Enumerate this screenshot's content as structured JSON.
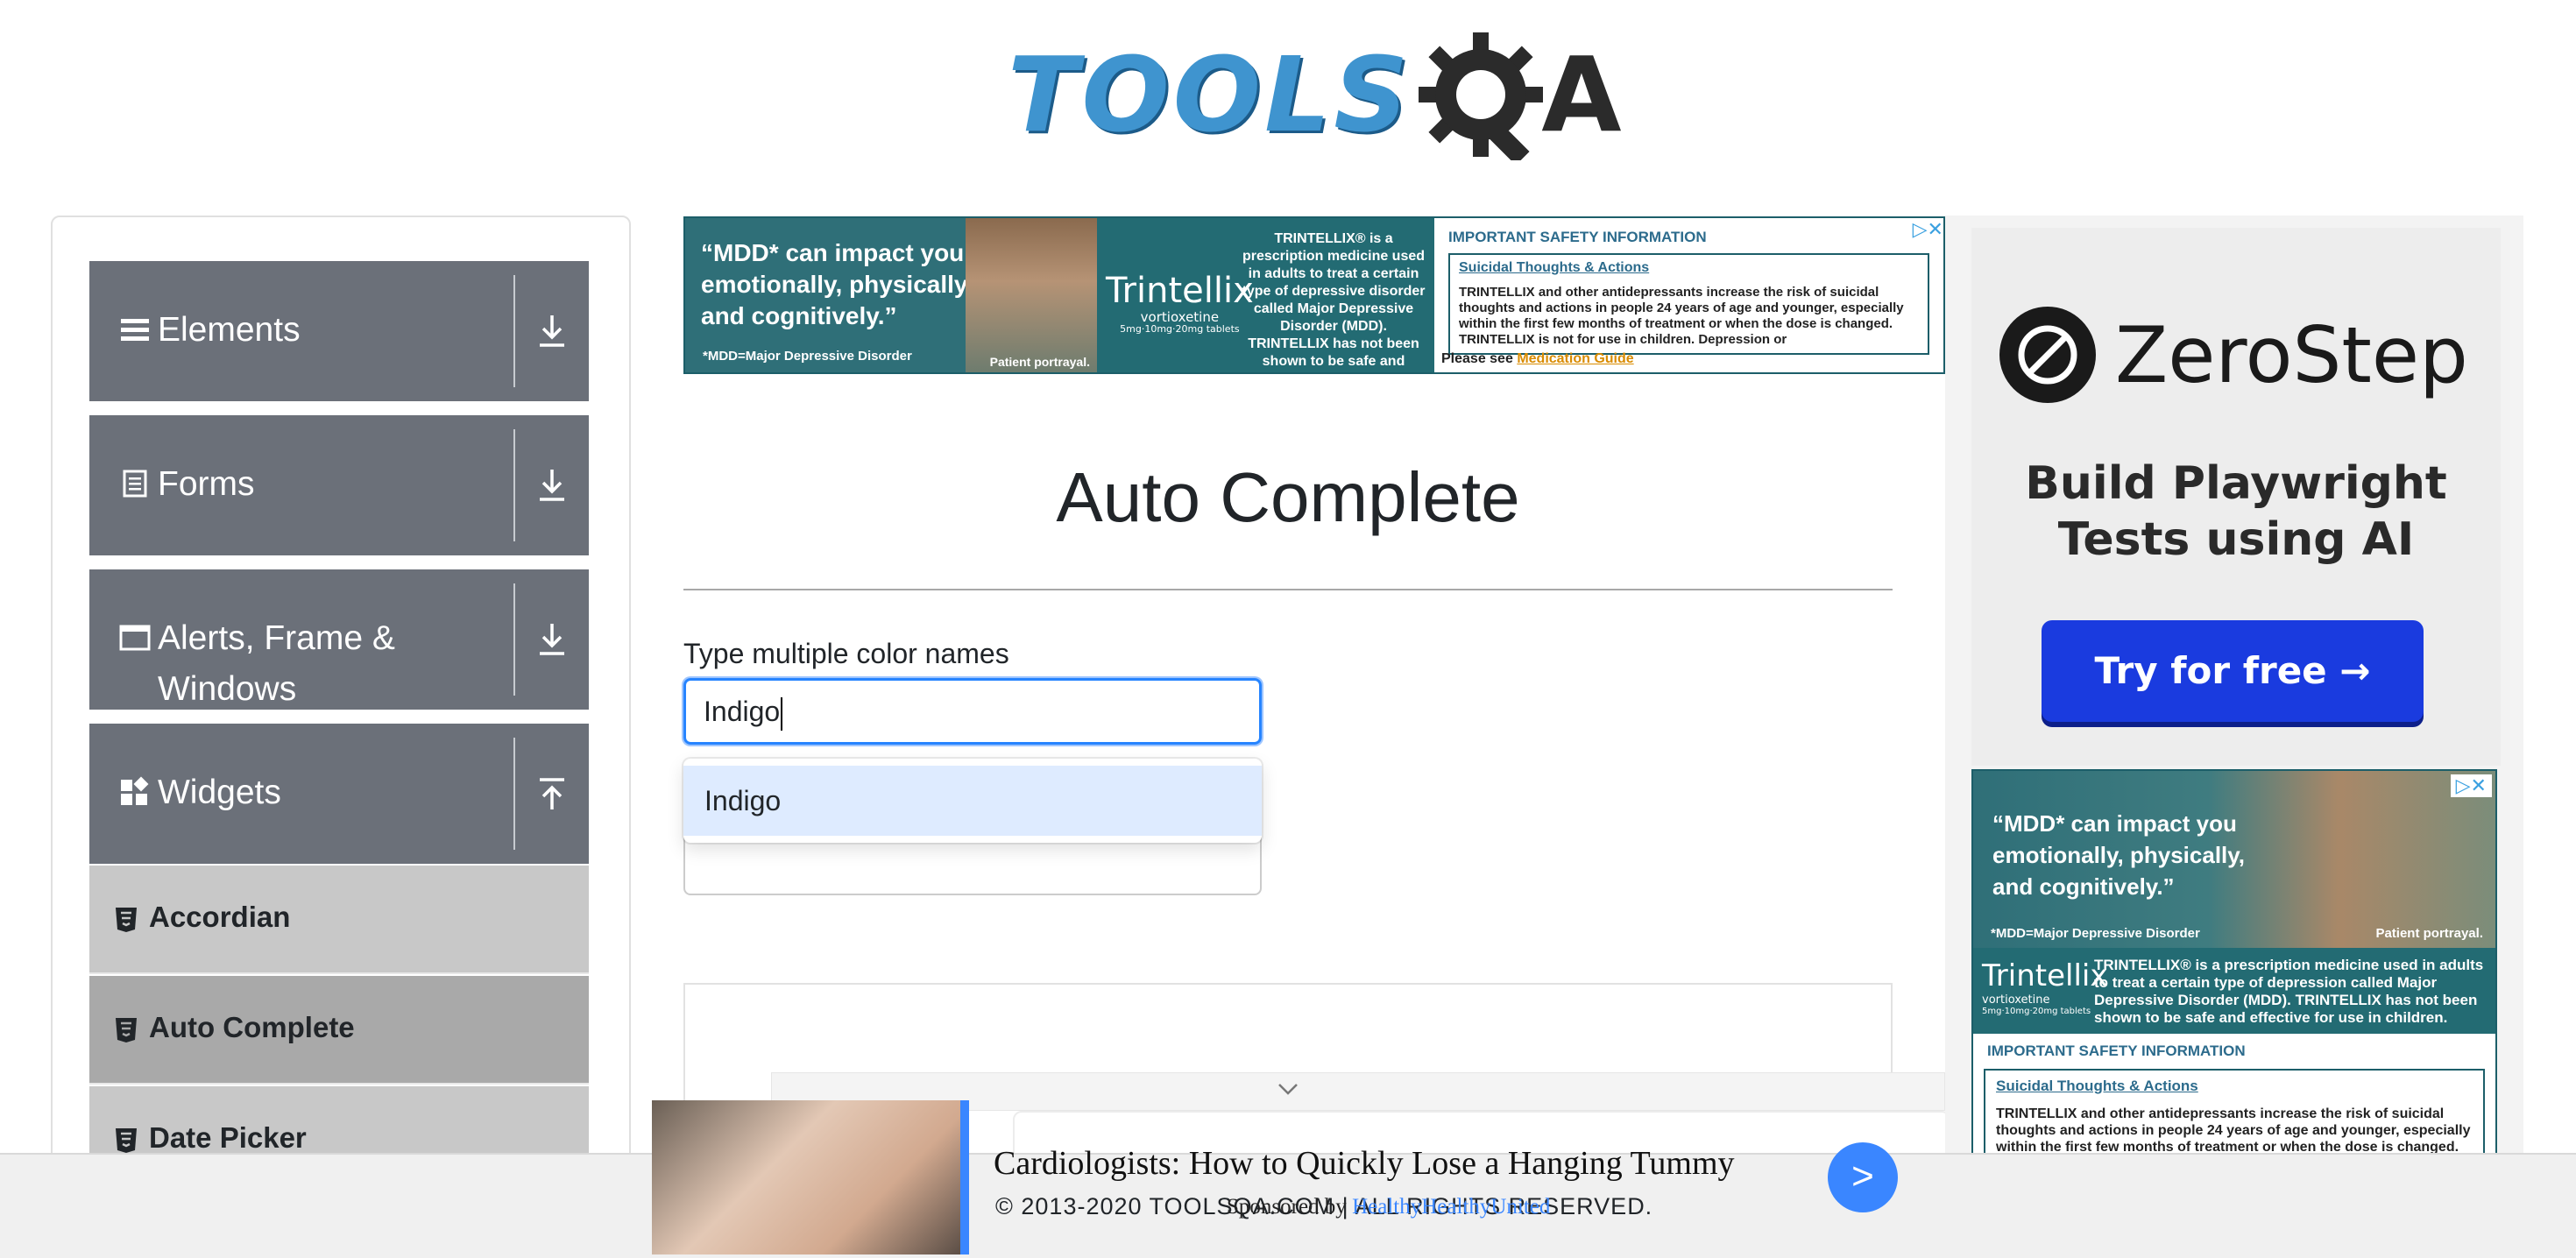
{
  "header": {
    "logo_text": "TOOLS",
    "logo_q": "Q",
    "logo_a": "A"
  },
  "sidebar": {
    "groups": [
      {
        "label": "Elements",
        "icon": "menu-icon",
        "toggle": "download-icon"
      },
      {
        "label": "Forms",
        "icon": "form-icon",
        "toggle": "download-icon"
      },
      {
        "label": "Alerts, Frame & Windows",
        "icon": "window-icon",
        "toggle": "download-icon"
      },
      {
        "label": "Widgets",
        "icon": "widgets-icon",
        "toggle": "upload-icon"
      }
    ],
    "items": [
      {
        "label": "Accordian",
        "active": false
      },
      {
        "label": "Auto Complete",
        "active": true
      },
      {
        "label": "Date Picker",
        "active": false
      }
    ]
  },
  "main": {
    "title": "Auto Complete",
    "multi_label": "Type multiple color names",
    "multi_value": "Indigo",
    "suggestions": [
      "Indigo"
    ]
  },
  "ad_top": {
    "quote": "“MDD* can impact you emotionally, physically, and cognitively.”",
    "footnote": "*MDD=Major Depressive Disorder",
    "portrayal": "Patient portrayal.",
    "brand": "Trintellix",
    "brand_generic": "vortioxetine",
    "brand_dose": "5mg·10mg·20mg tablets",
    "rx_text": "TRINTELLIX® is a prescription medicine used in adults to treat a certain type of depressive disorder called Major Depressive Disorder (MDD). TRINTELLIX has not been shown to be safe and effective for use in children.",
    "isi": "IMPORTANT SAFETY INFORMATION",
    "link": "Suicidal Thoughts & Actions",
    "body": "TRINTELLIX and other antidepressants increase the risk of suicidal thoughts and actions in people 24 years of age and younger, especially within the first few months of treatment or when the dose is changed. TRINTELLIX is not for use in children. Depression or",
    "guide_prefix": "Please see",
    "guide_link": "Medication Guide"
  },
  "ad_right": {
    "brand": "ZeroStep",
    "tagline": "Build Playwright Tests using AI",
    "cta": "Try for free →",
    "quote": "“MDD* can impact you emotionally, physically, and cognitively.”",
    "footnote": "*MDD=Major Depressive Disorder",
    "portrayal": "Patient portrayal.",
    "brand2": "Trintellix",
    "brand2_generic": "vortioxetine",
    "brand2_dose": "5mg·10mg·20mg tablets",
    "rx_text": "TRINTELLIX® is a prescription medicine used in adults to treat a certain type of depression called Major Depressive Disorder (MDD). TRINTELLIX has not been shown to be safe and effective for use in children.",
    "isi": "IMPORTANT SAFETY INFORMATION",
    "link": "Suicidal Thoughts & Actions",
    "body": "TRINTELLIX and other antidepressants increase the risk of suicidal thoughts and actions in people 24 years of age and younger, especially within the first few months of treatment or when the dose is changed. TRINTELLIX is not for use in children. Depression or"
  },
  "sponsored": {
    "title": "Cardiologists: How to Quickly Lose a Hanging Tummy",
    "by_prefix": "Sponsored by",
    "by_source": "HealthyHealthyUnited",
    "go": ">"
  },
  "footer": {
    "copyright": "© 2013-2020 TOOLSQA.COM | ALL RIGHTS RESERVED."
  },
  "colors": {
    "sidebar_group": "#6b7079",
    "sidebar_item": "#c8c8c8",
    "sidebar_item_active": "#a9a9a9",
    "focus_border": "#2684ff",
    "option_highlight": "#deebff",
    "cta_blue": "#1a3bdf",
    "ad_teal": "#236b73"
  }
}
